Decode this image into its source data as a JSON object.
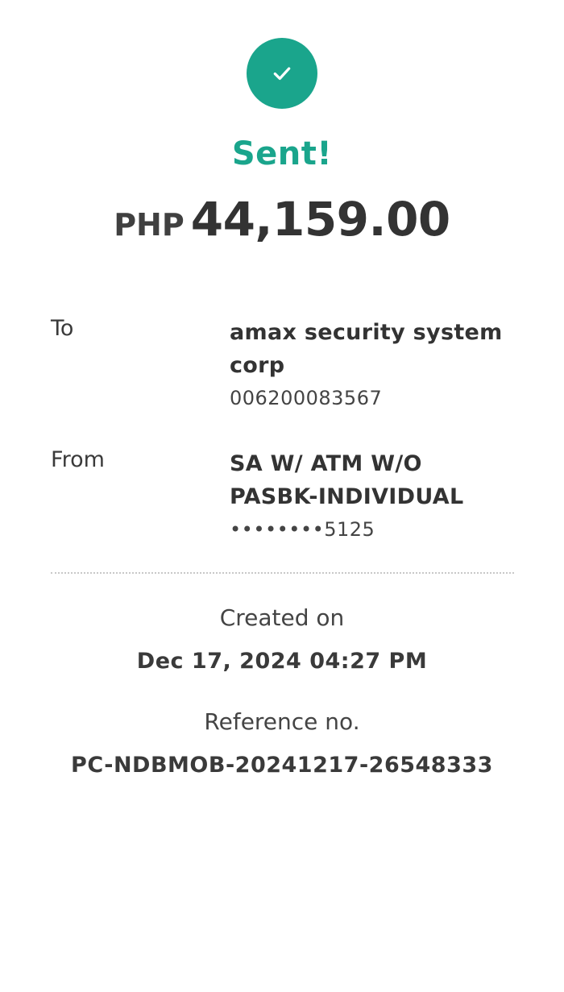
{
  "status": {
    "icon": "check-icon",
    "title": "Sent!",
    "accent_color": "#1aa58c"
  },
  "amount": {
    "currency": "PHP",
    "value": "44,159.00"
  },
  "to": {
    "label": "To",
    "name_line1": "amax security system",
    "name_line2": "corp",
    "account": "006200083567"
  },
  "from": {
    "label": "From",
    "name_line1": "SA W/ ATM W/O",
    "name_line2": "PASBK-INDIVIDUAL",
    "account": "••••••••5125"
  },
  "created": {
    "label": "Created on",
    "value": "Dec 17, 2024 04:27 PM"
  },
  "reference": {
    "label": "Reference no.",
    "value": "PC-NDBMOB-20241217-26548333"
  }
}
